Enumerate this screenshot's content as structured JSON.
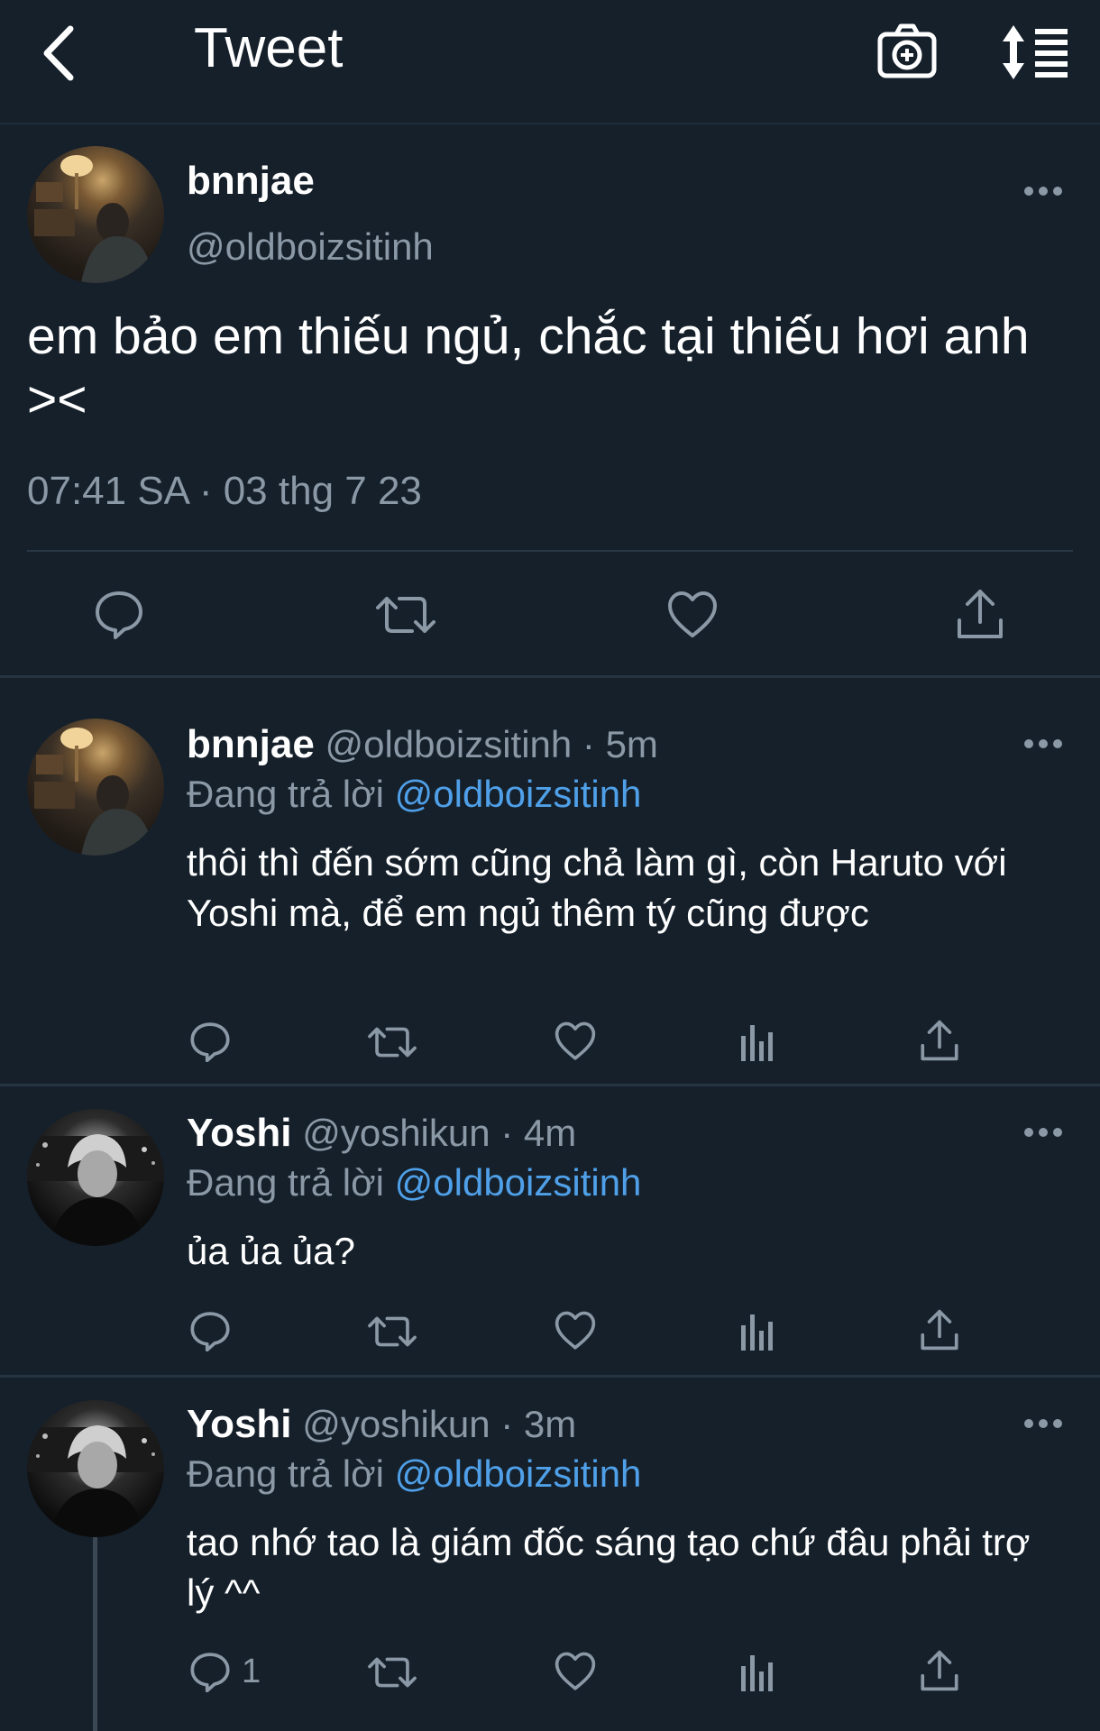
{
  "header": {
    "title": "Tweet",
    "back_icon": "chevron-left-icon",
    "camera_icon": "camera-add-icon",
    "sort_icon": "sort-list-icon"
  },
  "main_tweet": {
    "name": "bnnjae",
    "handle": "@oldboizsitinh",
    "text": "em bảo em thiếu ngủ, chắc tại thiếu hơi anh ><",
    "timestamp": "07:41 SA · 03 thg 7 23"
  },
  "replies": [
    {
      "name": "bnnjae",
      "meta": "@oldboizsitinh · 5m",
      "replying_prefix": "Đang trả lời",
      "replying_to": "@oldboizsitinh",
      "text": "thôi thì đến sớm cũng chả làm gì, còn Haruto với Yoshi mà, để em ngủ thêm tý cũng được"
    },
    {
      "name": "Yoshi",
      "meta": "@yoshikun · 4m",
      "replying_prefix": "Đang trả lời",
      "replying_to": "@oldboizsitinh",
      "text": "ủa ủa ủa?"
    },
    {
      "name": "Yoshi",
      "meta": "@yoshikun · 3m",
      "replying_prefix": "Đang trả lời",
      "replying_to": "@oldboizsitinh",
      "text": "tao nhớ tao là giám đốc sáng tạo chứ đâu phải trợ lý ^^",
      "reply_count": "1"
    }
  ],
  "colors": {
    "background": "#15202b",
    "secondary_text": "#8b98a5",
    "link": "#4fa0e8",
    "divider": "#263442"
  }
}
